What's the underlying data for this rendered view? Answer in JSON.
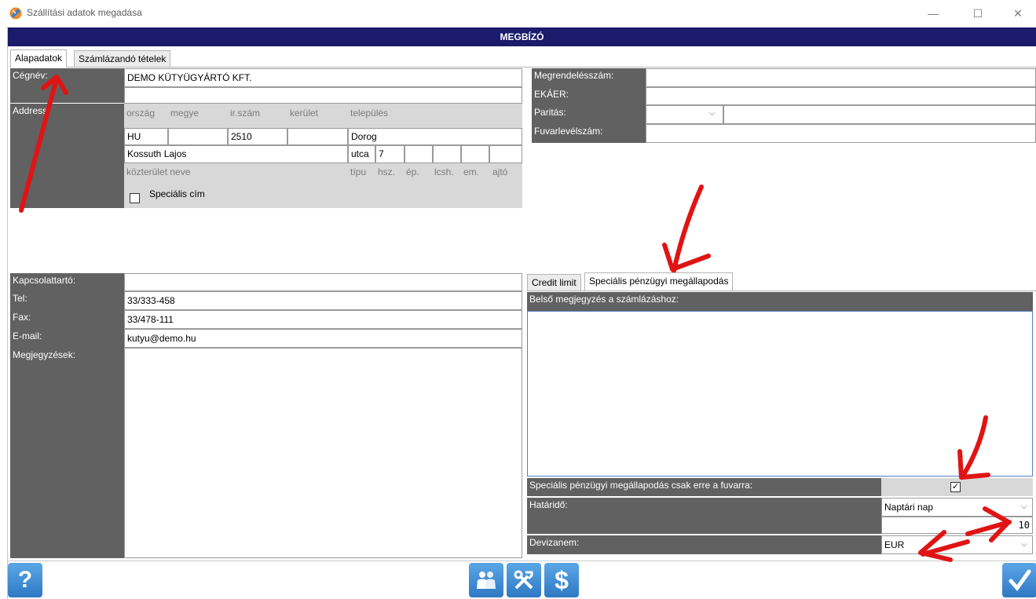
{
  "window": {
    "title": "Szállítási adatok megadása",
    "minimize": "—",
    "maximize": "☐",
    "close": "✕"
  },
  "header": {
    "title": "MEGBÍZÓ"
  },
  "tabs": [
    {
      "label": "Alapadatok"
    },
    {
      "label": "Számlázandó tételek"
    }
  ],
  "left": {
    "company_label": "Cégnév:",
    "company_value": "DEMO KÜTYÜGYÁRTÓ KFT.",
    "address_label": "Address:",
    "addr_headers": [
      "ország",
      "megye",
      "ir.szám",
      "kerület",
      "település"
    ],
    "country": "HU",
    "county": "",
    "zip": "2510",
    "district": "",
    "city": "Dorog",
    "street": "Kossuth Lajos",
    "street_type": "utca",
    "house": "7",
    "addr_headers2": [
      "közterület neve",
      "típu",
      "hsz.",
      "ép.",
      "lcsh.",
      "em.",
      "ajtó"
    ],
    "special_address": "Speciális cím",
    "contact_label": "Kapcsolattartó:",
    "contact_value": "",
    "tel_label": "Tel:",
    "tel_value": "33/333-458",
    "fax_label": "Fax:",
    "fax_value": "33/478-111",
    "email_label": "E-mail:",
    "email_value": "kutyu@demo.hu",
    "notes_label": "Megjegyzések:"
  },
  "right": {
    "order_label": "Megrendelésszám:",
    "order_value": "",
    "ekaer_label": "EKÁER:",
    "ekaer_value": "",
    "parity_label": "Paritás:",
    "parity_value": "",
    "waybill_label": "Fuvarlevélszám:",
    "waybill_value": ""
  },
  "subtabs": [
    {
      "label": "Credit limit"
    },
    {
      "label": "Speciális pénzügyi megállapodás"
    }
  ],
  "finance": {
    "note_label": "Belső megjegyzés a számlázáshoz:",
    "special_only_label": "Speciális pénzügyi megállapodás csak erre a fuvarra:",
    "special_only_checked": true,
    "deadline_label": "Határidő:",
    "deadline_type": "Naptári nap",
    "deadline_days": "10",
    "currency_label": "Devizanem:",
    "currency_value": "EUR"
  },
  "toolbar": {
    "help": "?",
    "dollar": "$"
  },
  "icons": [
    "app-icon",
    "help-icon",
    "users-icon",
    "tools-icon",
    "dollar-icon",
    "confirm-check-icon",
    "chevron-down-icon"
  ],
  "colors": {
    "header": "#1a1b6b",
    "label_bg": "#616161",
    "button": "#2f78c4",
    "annotation_arrow": "#e01414"
  }
}
